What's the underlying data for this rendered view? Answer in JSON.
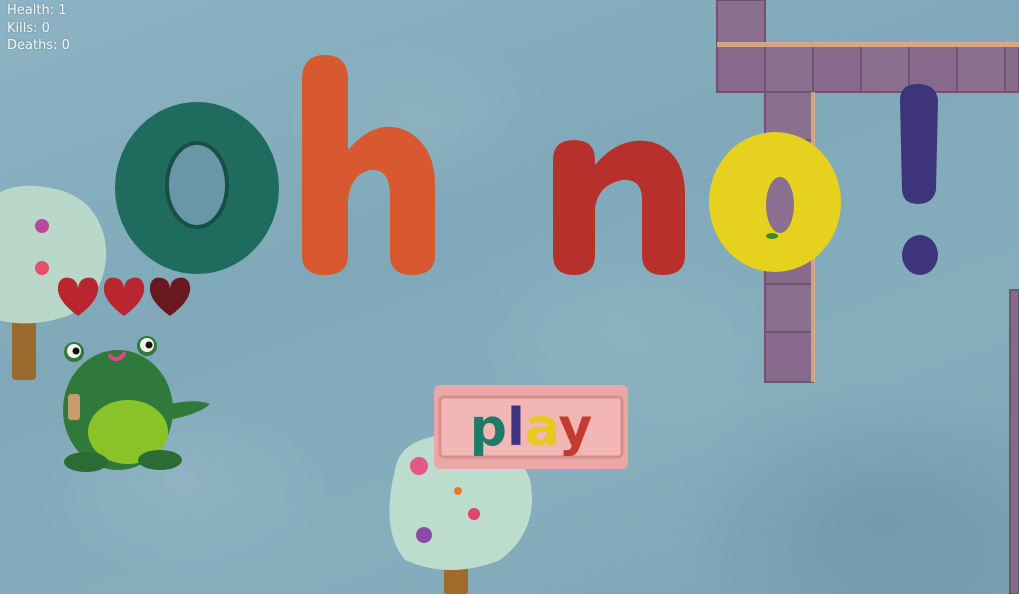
{
  "hud": {
    "health": "Health: 1",
    "kills": "Kills: 0",
    "deaths": "Deaths: 0"
  },
  "title": {
    "letters": [
      {
        "char": "o",
        "color": "#1f6b5e"
      },
      {
        "char": "h",
        "color": "#d8582f"
      },
      {
        "char": "n",
        "color": "#b8302c"
      },
      {
        "char": "o",
        "color": "#e6d21e"
      },
      {
        "char": "!",
        "color": "#3e347a"
      }
    ]
  },
  "play_button": {
    "label": "play",
    "letter_colors": [
      "#1f7a6a",
      "#3d3480",
      "#e8c91e",
      "#c63b2f"
    ]
  },
  "player": {
    "hearts": 3,
    "hearts_full": 2
  },
  "colors": {
    "background": "#86aebd",
    "wall": "#8a6f8e",
    "frog": "#2f7a3a",
    "frog_belly": "#8ac22a",
    "heart": "#b9262f",
    "heart_empty": "#6a1820",
    "sign": "#f2b7b4"
  }
}
